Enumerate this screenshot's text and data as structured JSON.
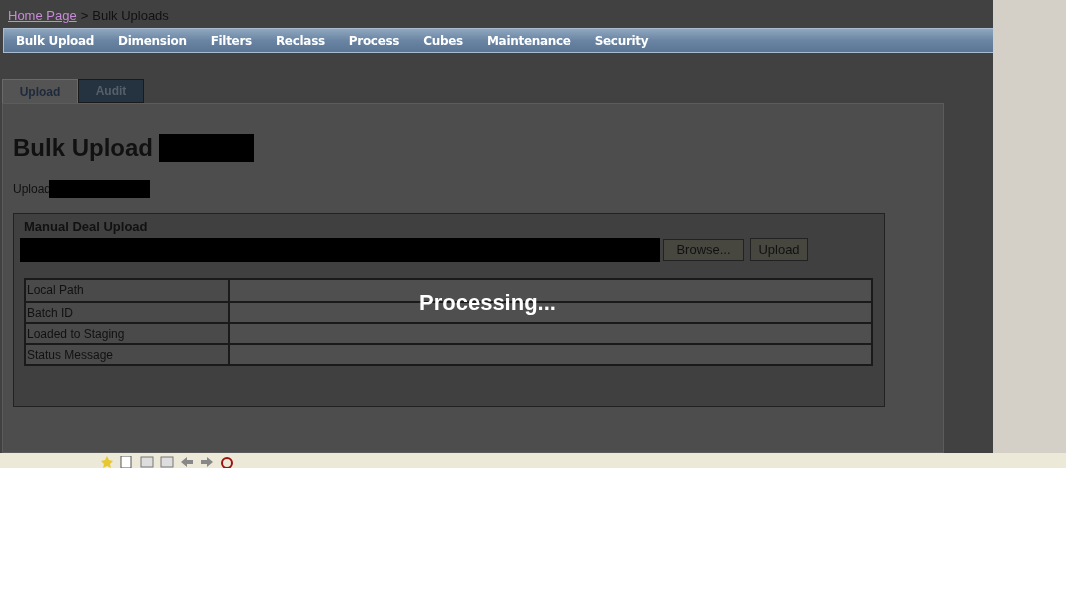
{
  "breadcrumb": {
    "link": "Home Page",
    "separator": ">",
    "current": "Bulk Uploads"
  },
  "menu": [
    "Bulk Upload",
    "Dimension",
    "Filters",
    "Reclass",
    "Process",
    "Cubes",
    "Maintenance",
    "Security"
  ],
  "tabs": [
    {
      "label": "Upload",
      "selected": true
    },
    {
      "label": "Audit",
      "selected": false
    }
  ],
  "heading": "Bulk Upload",
  "subheading": "Upload",
  "section": {
    "title": "Manual Deal Upload",
    "browse": "Browse...",
    "upload": "Upload",
    "rows": [
      {
        "label": "Local Path"
      },
      {
        "label": "Batch ID"
      },
      {
        "label": "Loaded to Staging"
      },
      {
        "label": "Status Message"
      }
    ]
  },
  "overlay": "Processing..."
}
